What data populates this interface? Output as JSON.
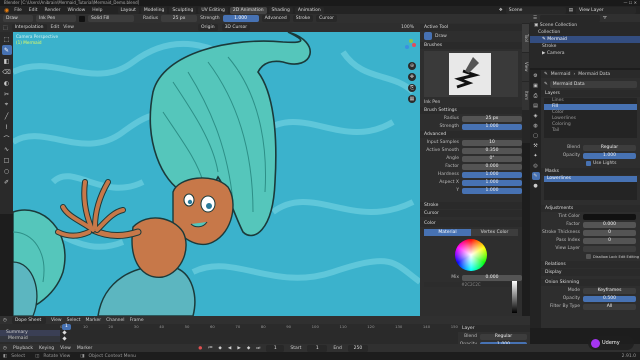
{
  "titlebar": {
    "title": "Blender [C:\\Users\\Anibrain\\Mermaid_Tutorial\\Mermaid_Demo.blend]"
  },
  "menubar": {
    "items": [
      "File",
      "Edit",
      "Render",
      "Window",
      "Help"
    ],
    "workspace_tabs": [
      "Layout",
      "Modeling",
      "Sculpting",
      "UV Editing",
      "2D Animation",
      "Shading",
      "Animation"
    ],
    "active_workspace": "2D Animation",
    "scene": "Scene",
    "view_layer": "View Layer"
  },
  "tool_header": {
    "mode": "Draw",
    "brush": "Ink Pen",
    "material": "Solid Fill",
    "radius_label": "Radius",
    "radius_value": "25 px",
    "strength_label": "Strength",
    "strength_value": "1.000",
    "advanced": "Advanced",
    "stroke": "Stroke",
    "cursor": "Cursor"
  },
  "viewport_header": {
    "interpolation": "Interpolation",
    "edit": "Edit",
    "view": "View",
    "origin": "Origin",
    "guide": "3D Cursor",
    "overlay_pct": "100%"
  },
  "viewport": {
    "camera_label": "Camera Perspective",
    "object_label": "(1) Mermaid",
    "colors": {
      "water": "#3bb2cc",
      "water_light": "#63c9dd",
      "hair": "#55c6bb",
      "hair_dark": "#2d8f87",
      "skin": "#c77849",
      "tail": "#5cb6c0"
    }
  },
  "toolbar_icons": [
    "select-icon",
    "draw-icon",
    "fill-icon",
    "erase-icon",
    "tint-icon",
    "cutter-icon",
    "eyedropper-icon",
    "line-icon",
    "polyline-icon",
    "arc-icon",
    "curve-icon",
    "box-icon",
    "circle-icon",
    "annotate-icon"
  ],
  "sidebar": {
    "tabs": [
      "Tool",
      "View",
      "Item"
    ],
    "active_tool_header": "Active Tool",
    "active_tool_name": "Draw",
    "brushes_header": "Brushes",
    "brush_name": "Ink Pen",
    "brush_settings_header": "Brush Settings",
    "radius_label": "Radius",
    "radius_value": "25 px",
    "strength_label": "Strength",
    "strength_value": "1.000",
    "advanced_header": "Advanced",
    "advanced_fields": [
      {
        "label": "Input Samples",
        "value": "10"
      },
      {
        "label": "Active Smooth",
        "value": "0.350"
      },
      {
        "label": "Angle",
        "value": "0°"
      },
      {
        "label": "Factor",
        "value": "0.000"
      },
      {
        "label": "Hardness",
        "value": "1.000"
      },
      {
        "label": "Aspect X",
        "value": "1.000"
      },
      {
        "label": "Y",
        "value": "1.000"
      }
    ],
    "stroke_header": "Stroke",
    "cursor_header": "Cursor",
    "color_header": "Color",
    "color_tabs": [
      "Material",
      "Vertex Color"
    ],
    "color_mix_label": "Mix",
    "color_mix_value": "0.000",
    "color_hex": "#2C2C2C"
  },
  "outliner": {
    "header": "Scene Collection",
    "rows": [
      {
        "name": "Collection",
        "sel": false
      },
      {
        "name": "Mermaid",
        "sel": true
      },
      {
        "name": "Stroke",
        "sel": false
      },
      {
        "name": "Camera",
        "sel": false
      }
    ]
  },
  "properties": {
    "object_name": "Mermaid",
    "data_name": "Mermaid Data",
    "layers_header": "Layers",
    "layers": [
      {
        "name": "Lines",
        "sel": false
      },
      {
        "name": "Fill",
        "sel": true
      },
      {
        "name": "Color",
        "sel": false
      },
      {
        "name": "Lowerlines",
        "sel": false
      },
      {
        "name": "Coloring",
        "sel": false
      },
      {
        "name": "Tail",
        "sel": false
      }
    ],
    "blend_label": "Blend",
    "blend_value": "Regular",
    "opacity_label": "Opacity",
    "opacity_value": "1.000",
    "use_lights": "Use Lights",
    "masks_header": "Masks",
    "mask_value": "Lowerlines",
    "adjustments_header": "Adjustments",
    "adjustments": [
      {
        "label": "Tint Color",
        "value": ""
      },
      {
        "label": "Factor",
        "value": "0.000"
      },
      {
        "label": "Stroke Thickness",
        "value": "0"
      },
      {
        "label": "Pass Index",
        "value": "0"
      },
      {
        "label": "View Layer",
        "value": ""
      }
    ],
    "disallow_label": "Disallow Lock Edit Editing",
    "relations_header": "Relations",
    "display_header": "Display",
    "onion_header": "Onion Skinning",
    "onion_mode_label": "Mode",
    "onion_mode_value": "Keyframes",
    "onion_opacity_label": "Opacity",
    "onion_opacity_value": "0.500",
    "filter_label": "Filter By Type",
    "filter_value": "All"
  },
  "timeline": {
    "mode": "Dope Sheet",
    "menus": [
      "View",
      "Select",
      "Marker",
      "Channel",
      "Frame"
    ],
    "summary": "Summary",
    "object_row": "Mermaid",
    "frame_numbers": [
      "0",
      "10",
      "20",
      "30",
      "40",
      "50",
      "60",
      "70",
      "80",
      "90",
      "100",
      "110",
      "120",
      "130",
      "140",
      "150"
    ],
    "current_frame": "1",
    "layer_header": "Layer",
    "layer_blend_label": "Blend",
    "layer_blend_value": "Regular",
    "layer_opacity_label": "Opacity",
    "layer_opacity_value": "1.000",
    "playback": "Playback",
    "keying": "Keying",
    "view": "View",
    "marker": "Marker",
    "start_label": "Start",
    "start_value": "1",
    "end_label": "End",
    "end_value": "250"
  },
  "statusbar": {
    "left": "Select",
    "mid": "Rotate View",
    "right": "Object Context Menu",
    "version": "2.91.0"
  },
  "watermark": "Udemy"
}
